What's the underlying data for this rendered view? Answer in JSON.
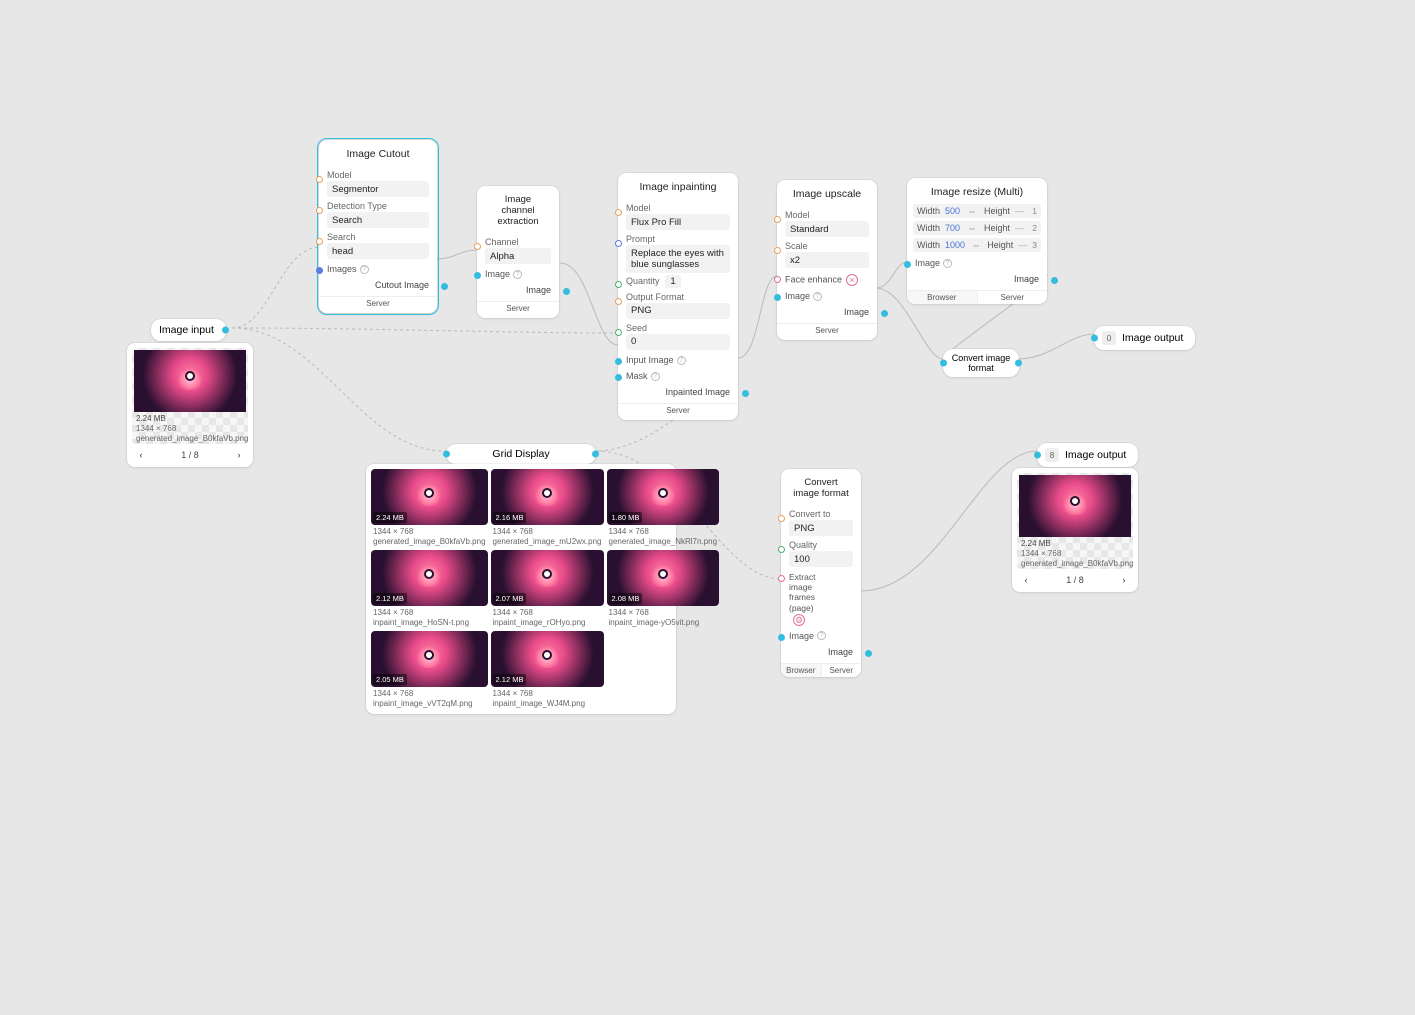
{
  "nodes": {
    "image_input": {
      "title": "Image input"
    },
    "image_cutout": {
      "title": "Image Cutout",
      "model_label": "Model",
      "model_value": "Segmentor",
      "det_label": "Detection Type",
      "det_value": "Search",
      "search_label": "Search",
      "search_value": "head",
      "images_label": "Images",
      "out_label": "Cutout Image",
      "foot": "Server"
    },
    "channel_extract": {
      "title": "Image channel extraction",
      "channel_label": "Channel",
      "channel_value": "Alpha",
      "image_label": "Image",
      "out_label": "Image",
      "foot": "Server"
    },
    "inpainting": {
      "title": "Image inpainting",
      "model_label": "Model",
      "model_value": "Flux Pro Fill",
      "prompt_label": "Prompt",
      "prompt_value": "Replace the eyes with blue sunglasses",
      "quantity_label": "Quantity",
      "quantity_value": "1",
      "of_label": "Output Format",
      "of_value": "PNG",
      "seed_label": "Seed",
      "seed_value": "0",
      "inimg_label": "Input Image",
      "mask_label": "Mask",
      "out_label": "Inpainted Image",
      "foot": "Server"
    },
    "upscale": {
      "title": "Image upscale",
      "model_label": "Model",
      "model_value": "Standard",
      "scale_label": "Scale",
      "scale_value": "x2",
      "face_label": "Face enhance",
      "image_label": "Image",
      "out_label": "Image",
      "foot": "Server"
    },
    "resize_multi": {
      "title": "Image resize (Multi)",
      "rows": [
        {
          "wl": "Width",
          "wv": "500",
          "hl": "Height",
          "hv": "—",
          "n": "1"
        },
        {
          "wl": "Width",
          "wv": "700",
          "hl": "Height",
          "hv": "—",
          "n": "2"
        },
        {
          "wl": "Width",
          "wv": "1000",
          "hl": "Height",
          "hv": "—",
          "n": "3"
        }
      ],
      "image_label": "Image",
      "out_label": "Image",
      "foot_left": "Browser",
      "foot_right": "Server"
    },
    "convert1": {
      "title": "Convert image format"
    },
    "convert2": {
      "title": "Convert image format",
      "ct_label": "Convert to",
      "ct_value": "PNG",
      "q_label": "Quality",
      "q_value": "100",
      "ef_label": "Extract image frames (page)",
      "image_label": "Image",
      "out_label": "Image",
      "foot_left": "Browser",
      "foot_right": "Server"
    },
    "grid_display": {
      "title": "Grid Display"
    },
    "output1": {
      "title": "Image output",
      "badge": "0"
    },
    "output2": {
      "title": "Image output",
      "badge": "8"
    }
  },
  "input_panel": {
    "size": "2.24 MB",
    "dims": "1344 × 768",
    "fname": "generated_image_B0kfaVb.png",
    "pager": "1 / 8"
  },
  "output_panel": {
    "size": "2.24 MB",
    "dims": "1344 × 768",
    "fname": "generated_image_B0kfaVb.png",
    "pager": "1 / 8"
  },
  "grid_items": [
    {
      "size": "2.24 MB",
      "dims": "1344 × 768",
      "fname": "generated_image_B0kfaVb.png"
    },
    {
      "size": "2.16 MB",
      "dims": "1344 × 768",
      "fname": "generated_image_mU2wx.png"
    },
    {
      "size": "1.80 MB",
      "dims": "1344 × 768",
      "fname": "generated_image_NkRl7n.png"
    },
    {
      "size": "2.12 MB",
      "dims": "1344 × 768",
      "fname": "inpaint_image_HoSN-t.png"
    },
    {
      "size": "2.07 MB",
      "dims": "1344 × 768",
      "fname": "inpaint_image_rOHyo.png"
    },
    {
      "size": "2.08 MB",
      "dims": "1344 × 768",
      "fname": "inpaint_image-yO5vit.png"
    },
    {
      "size": "2.05 MB",
      "dims": "1344 × 768",
      "fname": "inpaint_image_vVT2qM.png"
    },
    {
      "size": "2.12 MB",
      "dims": "1344 × 768",
      "fname": "inpaint_image_WJ4M.png"
    }
  ]
}
